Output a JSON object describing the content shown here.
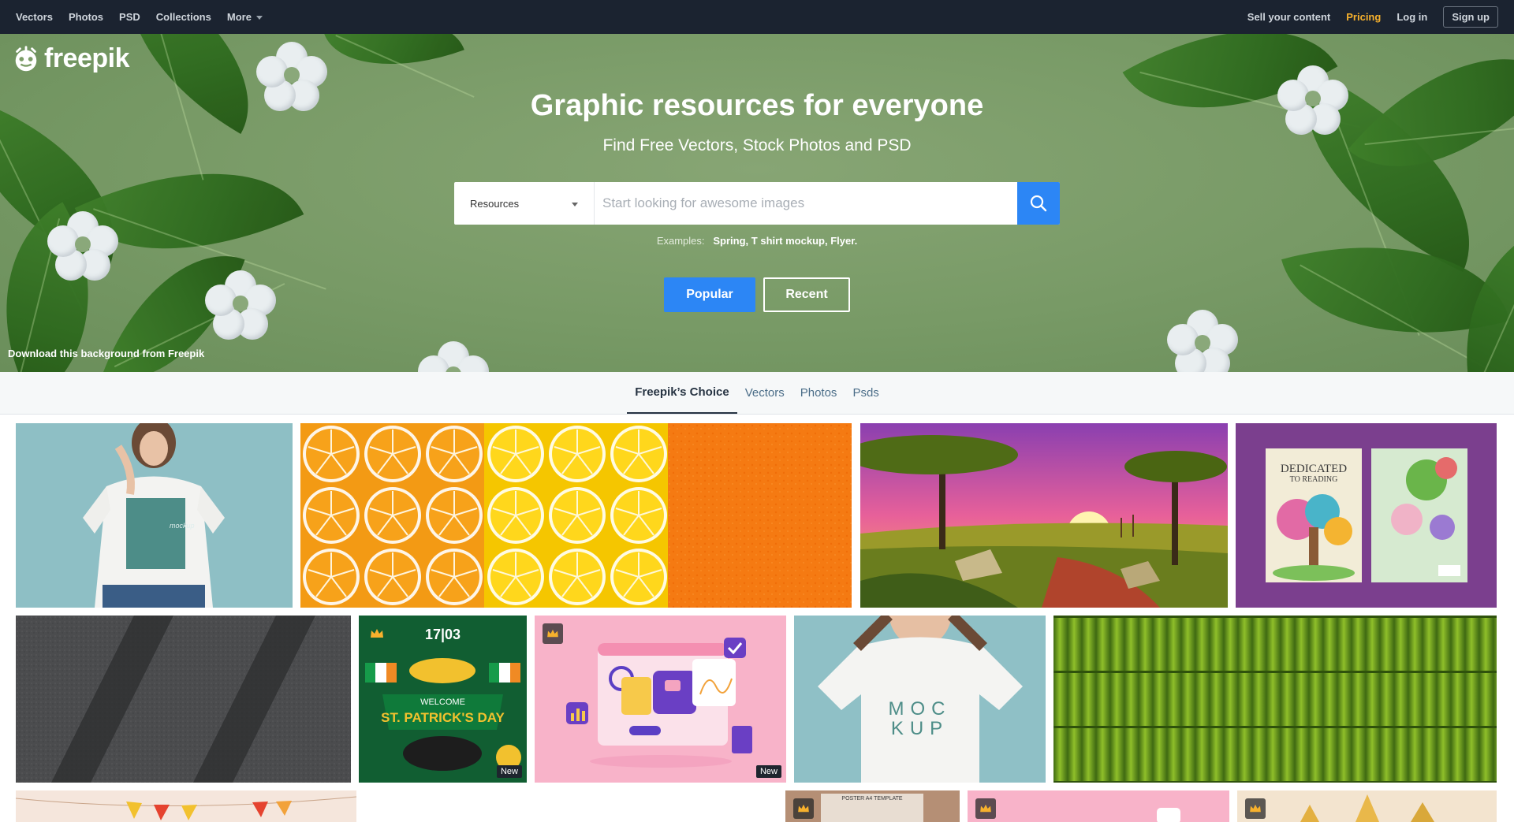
{
  "nav": {
    "left": [
      "Vectors",
      "Photos",
      "PSD",
      "Collections"
    ],
    "more": "More",
    "sell": "Sell your content",
    "pricing": "Pricing",
    "login": "Log in",
    "signup": "Sign up"
  },
  "hero": {
    "logo": "freepik",
    "title": "Graphic resources for everyone",
    "subtitle": "Find Free Vectors, Stock Photos and PSD",
    "search": {
      "select_value": "Resources",
      "placeholder": "Start looking for awesome images"
    },
    "examples_label": "Examples:",
    "examples": [
      "Spring",
      "T shirt mockup",
      "Flyer."
    ],
    "popular": "Popular",
    "recent": "Recent",
    "credit": "Download this background from Freepik"
  },
  "tabs": [
    "Freepik’s Choice",
    "Vectors",
    "Photos",
    "Psds"
  ],
  "tiles": {
    "mockup_text": "mockup",
    "patrick_top": "17|03",
    "patrick_welcome": "WELCOME",
    "patrick_title": "ST. PATRICK'S DAY",
    "book_title": "DEDICATED",
    "book_sub": "TO READING",
    "mock_1": "MOC",
    "mock_2": "KUP",
    "poster_label": "POSTER A4 TEMPLATE",
    "new": "New"
  },
  "colors": {
    "accent": "#2c86f5",
    "pricing": "#f7b12d",
    "nav_bg": "#1b2330"
  }
}
